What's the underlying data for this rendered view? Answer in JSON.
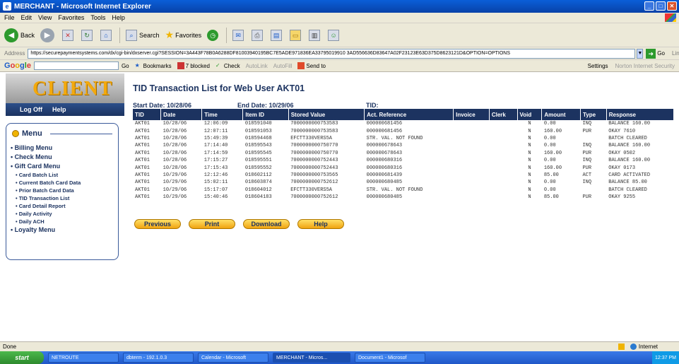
{
  "window": {
    "title": "MERCHANT - Microsoft Internet Explorer"
  },
  "menubar": [
    "File",
    "Edit",
    "View",
    "Favorites",
    "Tools",
    "Help"
  ],
  "toolbar": {
    "back": "Back",
    "search": "Search",
    "favorites": "Favorites"
  },
  "address": {
    "label": "Address",
    "url": "https://securepaymentsystems.com/dx/cgi-bin/dxserver.cgi?SESSION=3A443F78B0A6288DF81003940195BC7E5ADE971836EA33795019910 3AD556636D83647A02F23123E63D375D8623121D&OPTION=OPTIONS",
    "go": "Go",
    "links": "Links"
  },
  "googlebar": {
    "logo_g": "G",
    "logo_o1": "o",
    "logo_o2": "o",
    "logo_g2": "g",
    "logo_l": "l",
    "logo_e": "e",
    "go": "Go",
    "bookmarks": "Bookmarks",
    "blocked": "7 blocked",
    "check": "Check",
    "autolink": "AutoLink",
    "autofill": "AutoFill",
    "sendto": "Send to",
    "settings": "Settings",
    "norton": "Norton Internet Security"
  },
  "client": {
    "logo": "CLIENT",
    "logoff": "Log Off",
    "help": "Help"
  },
  "menu": {
    "title": "Menu",
    "items": [
      {
        "label": "Billing Menu",
        "sub": false
      },
      {
        "label": "Check Menu",
        "sub": false
      },
      {
        "label": "Gift Card Menu",
        "sub": false
      },
      {
        "label": "Card Batch List",
        "sub": true
      },
      {
        "label": "Current Batch Card Data",
        "sub": true
      },
      {
        "label": "Prior Batch Card Data",
        "sub": true
      },
      {
        "label": "TID Transaction List",
        "sub": true
      },
      {
        "label": "Card Detail Report",
        "sub": true
      },
      {
        "label": "Daily Activity",
        "sub": true
      },
      {
        "label": "Daily ACH",
        "sub": true
      },
      {
        "label": "Loyalty Menu",
        "sub": false
      }
    ]
  },
  "main": {
    "title": "TID Transaction List for Web User AKT01",
    "start_date": "Start Date: 10/28/06",
    "end_date": "End Date: 10/29/06",
    "tid": "TID:"
  },
  "table": {
    "headers": [
      "TID",
      "Date",
      "Time",
      "Item ID",
      "Stored Value",
      "Act. Reference",
      "Invoice",
      "Clerk",
      "Void",
      "Amount",
      "Type",
      "Response"
    ],
    "rows": [
      [
        "AKT01",
        "10/28/06",
        "12:06:09",
        "018591040",
        "7000000000753583",
        "000000681456",
        "",
        "",
        "N",
        "0.00",
        "INQ",
        "BALANCE 160.00"
      ],
      [
        "AKT01",
        "10/28/06",
        "12:07:11",
        "018591053",
        "7000000000753583",
        "000000681456",
        "",
        "",
        "N",
        "160.00",
        "PUR",
        "OKAY 7610"
      ],
      [
        "AKT01",
        "10/28/06",
        "15:49:39",
        "018594468",
        "EFCTT330VERS5A",
        "STR. VAL. NOT FOUND",
        "",
        "",
        "N",
        "0.00",
        "",
        "BATCH CLEARED"
      ],
      [
        "AKT01",
        "10/28/06",
        "17:14:40",
        "018595543",
        "7000000000750770",
        "000000678643",
        "",
        "",
        "N",
        "0.00",
        "INQ",
        "BALANCE 160.00"
      ],
      [
        "AKT01",
        "10/28/06",
        "17:14:59",
        "018595545",
        "7000000000750770",
        "000000678643",
        "",
        "",
        "N",
        "160.00",
        "PUR",
        "OKAY 0502"
      ],
      [
        "AKT01",
        "10/28/06",
        "17:15:27",
        "018595551",
        "7000000000752443",
        "000000680316",
        "",
        "",
        "N",
        "0.00",
        "INQ",
        "BALANCE 160.00"
      ],
      [
        "AKT01",
        "10/28/06",
        "17:15:43",
        "018595552",
        "7000000000752443",
        "000000680316",
        "",
        "",
        "N",
        "160.00",
        "PUR",
        "OKAY 0173"
      ],
      [
        "AKT01",
        "10/29/06",
        "12:12:46",
        "018602112",
        "7000000000753565",
        "000000681439",
        "",
        "",
        "N",
        "85.00",
        "ACT",
        "CARD ACTIVATED"
      ],
      [
        "AKT01",
        "10/29/06",
        "15:02:11",
        "018603874",
        "7000000000752612",
        "000000680485",
        "",
        "",
        "N",
        "0.00",
        "INQ",
        "BALANCE 85.00"
      ],
      [
        "AKT01",
        "10/29/06",
        "15:17:07",
        "018604012",
        "EFCTT330VERS5A",
        "STR. VAL. NOT FOUND",
        "",
        "",
        "N",
        "0.00",
        "",
        "BATCH CLEARED"
      ],
      [
        "AKT01",
        "10/29/06",
        "15:40:46",
        "018604183",
        "7000000000752612",
        "000000680485",
        "",
        "",
        "N",
        "85.00",
        "PUR",
        "OKAY 9255"
      ]
    ]
  },
  "actions": {
    "previous": "Previous",
    "print": "Print",
    "download": "Download",
    "help": "Help"
  },
  "status": {
    "left": "Done",
    "zone": "Internet"
  },
  "taskbar": {
    "start": "start",
    "tasks": [
      "NETROUTE",
      "dbterm - 192.1.0.3",
      "Calendar - Microsoft",
      "MERCHANT - Micros...",
      "Document1 - Microsof"
    ],
    "clock": "12:37 PM"
  },
  "colors": {
    "header_navy": "#1c3360",
    "accent_orange": "#f0a410",
    "xp_blue": "#2057c8"
  }
}
